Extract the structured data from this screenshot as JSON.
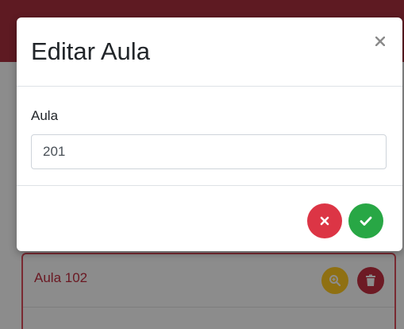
{
  "modal": {
    "title": "Editar Aula",
    "close_icon": "close-icon",
    "field_label": "Aula",
    "field_value": "201",
    "cancel_icon": "x-icon",
    "confirm_icon": "check-icon",
    "colors": {
      "cancel": "#dc3545",
      "confirm": "#28a745"
    }
  },
  "background_list": {
    "item_title": "Aula 102",
    "view_icon": "zoom-in-icon",
    "delete_icon": "trash-icon"
  }
}
